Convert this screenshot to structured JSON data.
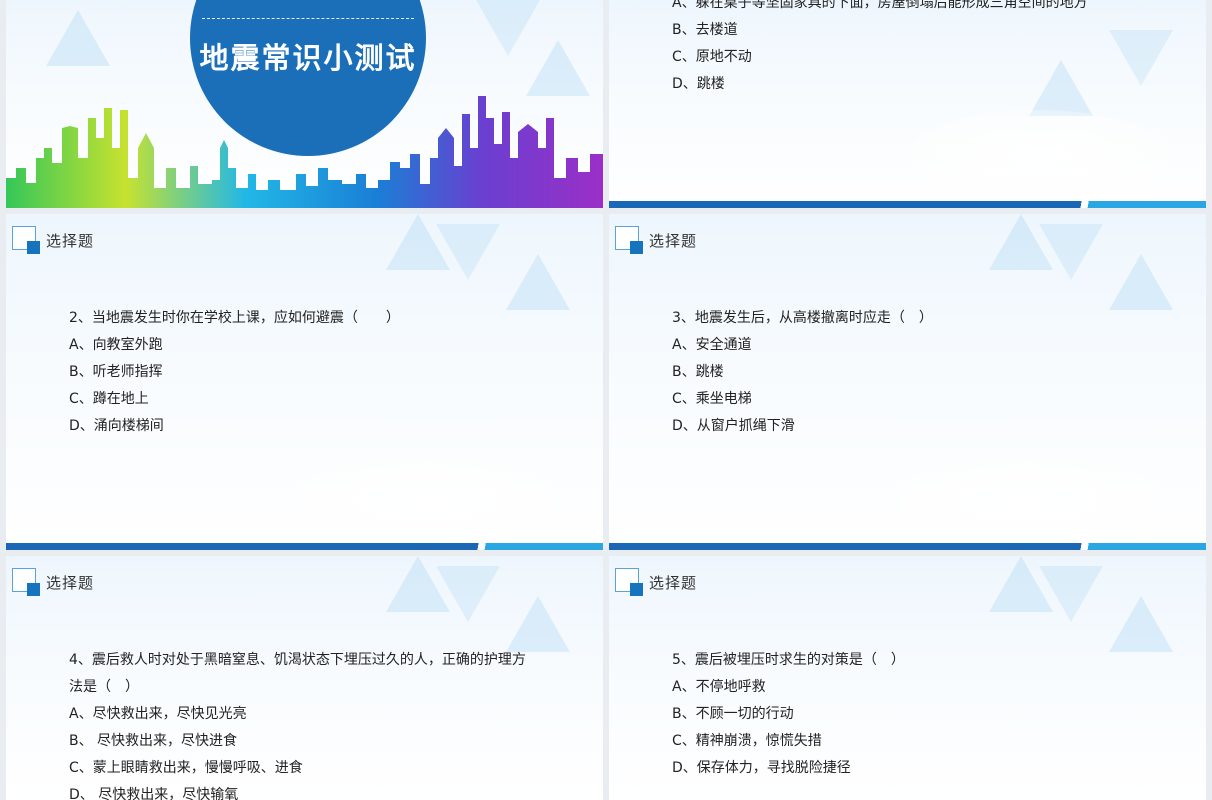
{
  "title_slide": {
    "title": "地震常识小测试"
  },
  "slide_partial": {
    "options": [
      "A、躲在桌子等坚固家具的下面，房屋倒塌后能形成三角空间的地方",
      "B、去楼道",
      "C、原地不动",
      "D、跳楼"
    ]
  },
  "slides": [
    {
      "header": "选择题",
      "question": "2、当地震发生时你在学校上课，应如何避震（　　）",
      "options": [
        "A、向教室外跑",
        "B、听老师指挥",
        "C、蹲在地上",
        "D、涌向楼梯间"
      ]
    },
    {
      "header": "选择题",
      "question": "3、地震发生后，从高楼撤离时应走（　）",
      "options": [
        "A、安全通道",
        "B、跳楼",
        "C、乘坐电梯",
        "D、从窗户抓绳下滑"
      ]
    },
    {
      "header": "选择题",
      "question": "4、震后救人时对处于黑暗窒息、饥渴状态下埋压过久的人，正确的护理方法是（　）",
      "options": [
        "A、尽快救出来，尽快见光亮",
        "B、 尽快救出来，尽快进食",
        "C、蒙上眼睛救出来，慢慢呼吸、进食",
        "D、 尽快救出来，尽快输氧"
      ]
    },
    {
      "header": "选择题",
      "question": "5、震后被埋压时求生的对策是（　）",
      "options": [
        "A、不停地呼救",
        "B、不顾一切的行动",
        "C、精神崩溃，惊慌失措",
        "D、保存体力，寻找脱险捷径"
      ]
    }
  ],
  "colors": {
    "primary_blue": "#1a6fb8",
    "accent_blue": "#2aa7e3",
    "text": "#222222"
  }
}
